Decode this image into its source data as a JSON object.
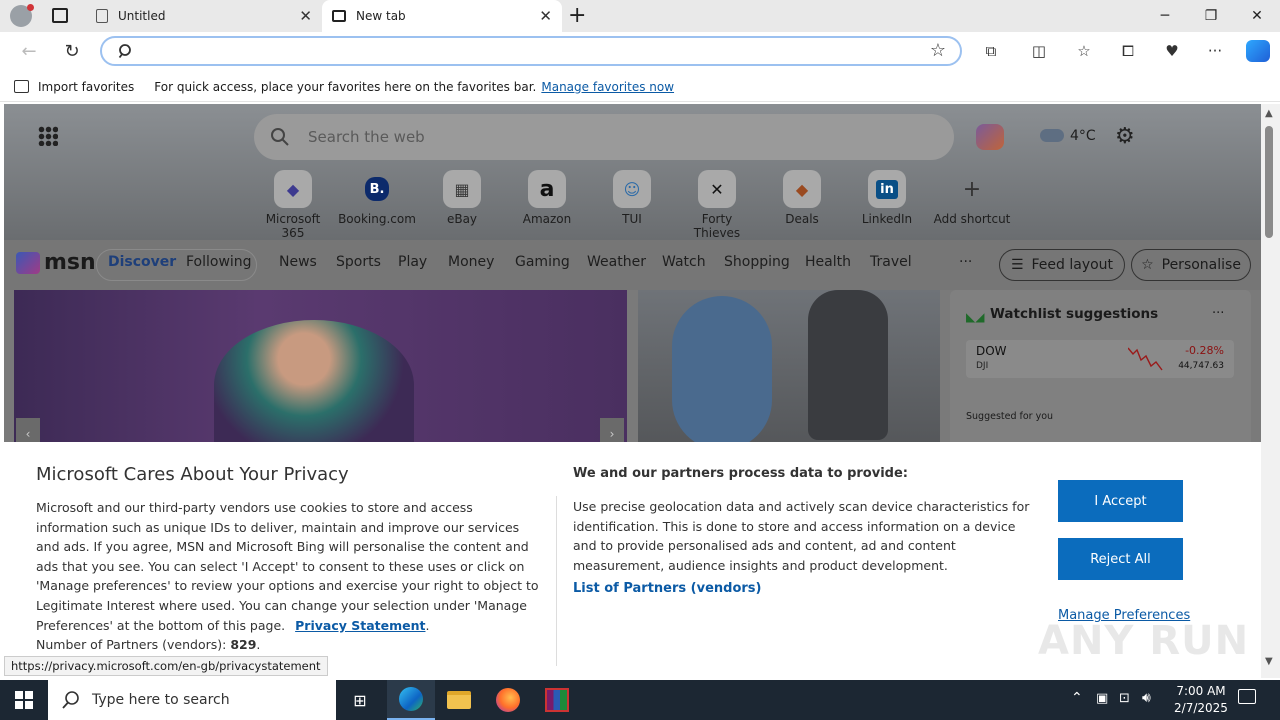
{
  "browser": {
    "tabs": [
      {
        "label": "Untitled",
        "close": "✕"
      },
      {
        "label": "New tab",
        "close": "✕"
      }
    ],
    "new_tab": "+",
    "favorites_bar": {
      "import_label": "Import favorites",
      "message": "For quick access, place your favorites here on the favorites bar.",
      "manage_link": "Manage favorites now"
    },
    "status_url": "https://privacy.microsoft.com/en-gb/privacystatement"
  },
  "msn": {
    "search_placeholder": "Search the web",
    "weather": "4°C",
    "shortcuts": [
      {
        "label": "Microsoft 365",
        "glyph": "◆"
      },
      {
        "label": "Booking.com",
        "glyph": "B."
      },
      {
        "label": "eBay",
        "glyph": "▦"
      },
      {
        "label": "Amazon",
        "glyph": "a"
      },
      {
        "label": "TUI",
        "glyph": "☺"
      },
      {
        "label": "Forty Thieves",
        "glyph": "✕"
      },
      {
        "label": "Deals",
        "glyph": "◆"
      },
      {
        "label": "LinkedIn",
        "glyph": "in"
      },
      {
        "label": "Add shortcut",
        "glyph": "+"
      }
    ],
    "logo": "msn",
    "nav_tabs": [
      "Discover",
      "Following"
    ],
    "nav_items": [
      "News",
      "Sports",
      "Play",
      "Money",
      "Gaming",
      "Weather",
      "Watch",
      "Shopping",
      "Health",
      "Travel"
    ],
    "more": "···",
    "feed_layout": "Feed layout",
    "personalise": "Personalise",
    "watchlist": {
      "title": "Watchlist suggestions",
      "more": "···",
      "stock": {
        "symbol": "DOW",
        "name": "DJI",
        "change": "-0.28%",
        "value": "44,747.63"
      },
      "suggested_label": "Suggested for you"
    }
  },
  "privacy": {
    "title": "Microsoft Cares About Your Privacy",
    "body": "Microsoft and our third-party vendors use cookies to store and access information such as unique IDs to deliver, maintain and improve our services and ads. If you agree, MSN and Microsoft Bing will personalise the content and ads that you see. You can select 'I Accept' to consent to these uses or click on 'Manage preferences' to review your options and exercise your right to object to Legitimate Interest where used.  You can change your selection under 'Manage Preferences' at the bottom of this page.",
    "privacy_link": "Privacy Statement",
    "partners_label": "Number of Partners (vendors):",
    "partners_count": "829",
    "right_title": "We and our partners process data to provide:",
    "right_body": "Use precise geolocation data and actively scan device characteristics for identification. This is done to store and access information on a device and to provide personalised ads and content, ad and content measurement, audience insights and product development.",
    "partners_link": "List of Partners (vendors)",
    "accept": "I Accept",
    "reject": "Reject All",
    "manage": "Manage Preferences"
  },
  "taskbar": {
    "search_placeholder": "Type here to search",
    "time": "7:00 AM",
    "date": "2/7/2025"
  },
  "watermark": "ANY RUN",
  "colors": {
    "accent": "#0b6cbd",
    "taskbar": "#1c2733",
    "negative": "#d13438"
  }
}
